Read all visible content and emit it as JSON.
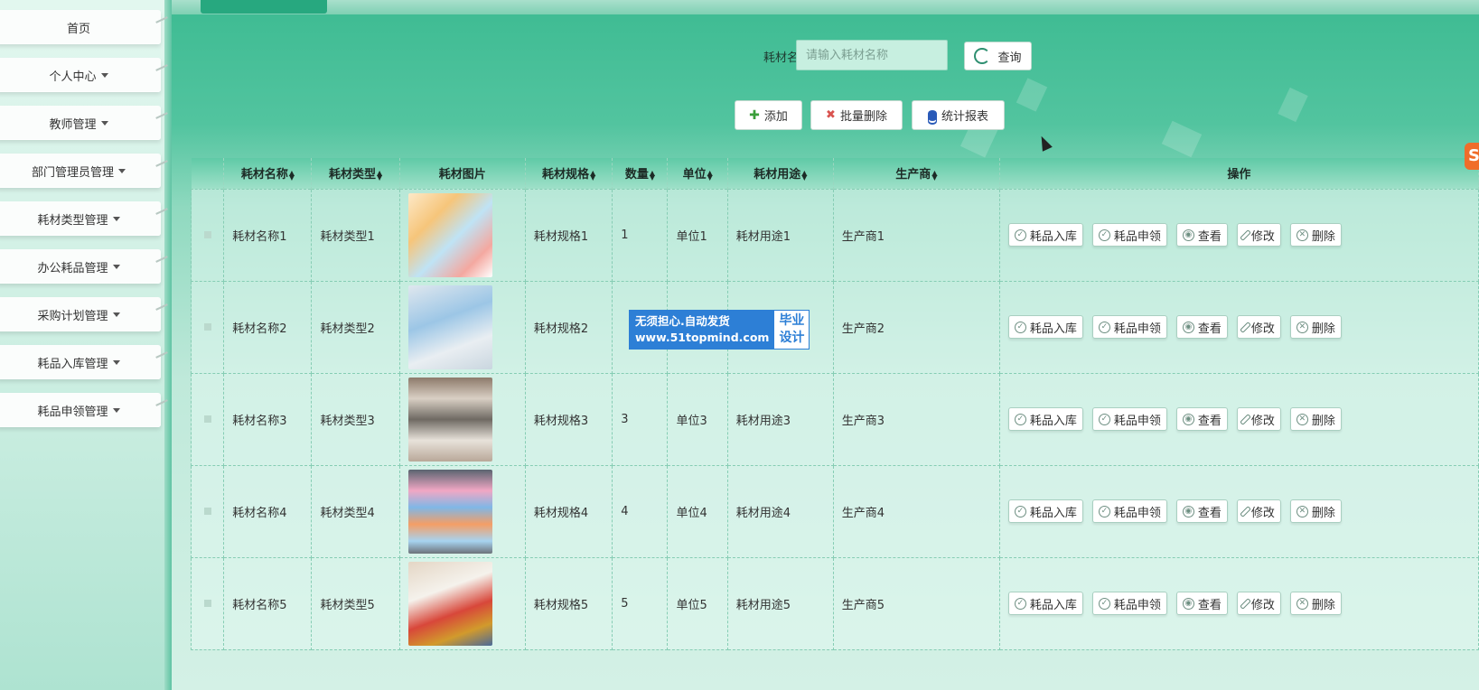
{
  "sidebar": {
    "items": [
      {
        "label": "首页",
        "dropdown": false
      },
      {
        "label": "个人中心",
        "dropdown": true
      },
      {
        "label": "教师管理",
        "dropdown": true
      },
      {
        "label": "部门管理员管理",
        "dropdown": true
      },
      {
        "label": "耗材类型管理",
        "dropdown": true
      },
      {
        "label": "办公耗品管理",
        "dropdown": true
      },
      {
        "label": "采购计划管理",
        "dropdown": true
      },
      {
        "label": "耗品入库管理",
        "dropdown": true
      },
      {
        "label": "耗品申领管理",
        "dropdown": true
      }
    ]
  },
  "search": {
    "label": "耗材名称",
    "placeholder": "请输入耗材名称",
    "button_label": "查询"
  },
  "actions": {
    "add": "添加",
    "batch_delete": "批量删除",
    "report": "统计报表"
  },
  "table": {
    "headers": [
      "耗材名称",
      "耗材类型",
      "耗材图片",
      "耗材规格",
      "数量",
      "单位",
      "耗材用途",
      "生产商",
      "操作"
    ],
    "rows": [
      {
        "name": "耗材名称1",
        "type": "耗材类型1",
        "spec": "耗材规格1",
        "qty": "1",
        "unit": "单位1",
        "usage": "耗材用途1",
        "maker": "生产商1"
      },
      {
        "name": "耗材名称2",
        "type": "耗材类型2",
        "spec": "耗材规格2",
        "qty": "",
        "unit": "",
        "usage": "用途2",
        "maker": "生产商2"
      },
      {
        "name": "耗材名称3",
        "type": "耗材类型3",
        "spec": "耗材规格3",
        "qty": "3",
        "unit": "单位3",
        "usage": "耗材用途3",
        "maker": "生产商3"
      },
      {
        "name": "耗材名称4",
        "type": "耗材类型4",
        "spec": "耗材规格4",
        "qty": "4",
        "unit": "单位4",
        "usage": "耗材用途4",
        "maker": "生产商4"
      },
      {
        "name": "耗材名称5",
        "type": "耗材类型5",
        "spec": "耗材规格5",
        "qty": "5",
        "unit": "单位5",
        "usage": "耗材用途5",
        "maker": "生产商5"
      }
    ],
    "ops": {
      "stock_in": "耗品入库",
      "apply": "耗品申领",
      "view": "查看",
      "edit": "修改",
      "delete": "删除"
    }
  },
  "watermark": {
    "line1": "无须担心.自动发货",
    "line2": "www.51topmind.com",
    "right1": "毕业",
    "right2": "设计"
  },
  "colors": {
    "accent": "#27a87f",
    "header_bg": "#5fcaa6",
    "watermark_blue": "#2d7fd6"
  }
}
